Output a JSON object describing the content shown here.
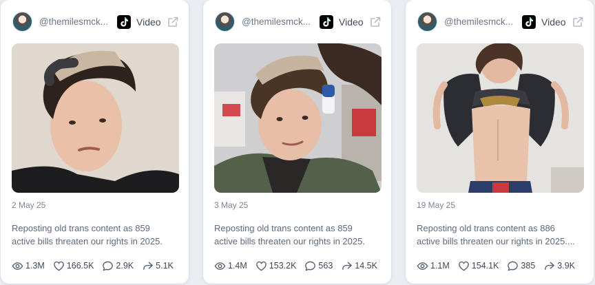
{
  "cards": [
    {
      "handle": "@themilesmck...",
      "type_label": "Video",
      "date": "2 May 25",
      "caption_line1": "Reposting old trans content as 859",
      "caption_line2": "active bills threaten our rights in 2025.",
      "views": "1.3M",
      "likes": "166.5K",
      "comments": "2.9K",
      "shares": "5.1K"
    },
    {
      "handle": "@themilesmck...",
      "type_label": "Video",
      "date": "3 May 25",
      "caption_line1": "Reposting old trans content as 859",
      "caption_line2": "active bills threaten our rights in 2025.",
      "views": "1.4M",
      "likes": "153.2K",
      "comments": "563",
      "shares": "14.5K"
    },
    {
      "handle": "@themilesmck...",
      "type_label": "Video",
      "date": "19 May 25",
      "caption_line1": "Reposting old trans content as 886",
      "caption_line2": "active bills threaten our rights in 2025....",
      "views": "1.1M",
      "likes": "154.1K",
      "comments": "385",
      "shares": "3.9K"
    }
  ],
  "icons": {
    "platform": "tiktok-icon",
    "external": "external-link-icon",
    "views": "eye-icon",
    "likes": "heart-icon",
    "comments": "comment-icon",
    "shares": "share-icon"
  },
  "colors": {
    "background": "#e9ecf1",
    "card": "#ffffff",
    "text_muted": "#6c7889",
    "text_stat": "#3f4959"
  }
}
